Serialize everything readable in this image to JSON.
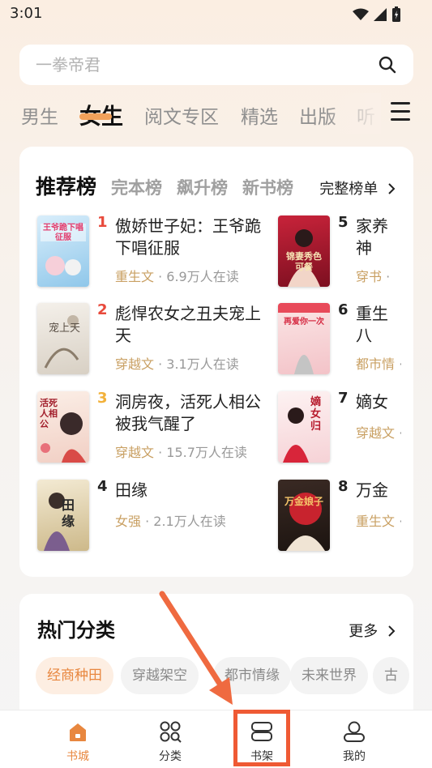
{
  "status": {
    "time": "3:01"
  },
  "search": {
    "placeholder": "一拳帝君"
  },
  "channels": [
    "男生",
    "女生",
    "阅文专区",
    "精选",
    "出版",
    "听"
  ],
  "rank": {
    "tabs": [
      "推荐榜",
      "完本榜",
      "飙升榜",
      "新书榜"
    ],
    "more": "完整榜单",
    "books": [
      {
        "rank": "1",
        "title": "傲娇世子妃：王爷跪下唱征服",
        "genre": "重生文",
        "readers": " · 6.9万人在读",
        "cover_text": "王爷跪下唱征服",
        "rank_color": "#e84a3c"
      },
      {
        "rank": "2",
        "title": "彪悍农女之丑夫宠上天",
        "genre": "穿越文",
        "readers": " · 3.1万人在读",
        "cover_text": "宠上天",
        "rank_color": "#e84a3c"
      },
      {
        "rank": "3",
        "title": "洞房夜，活死人相公被我气醒了",
        "genre": "穿越文",
        "readers": " · 15.7万人在读",
        "cover_text": "活死人相公",
        "rank_color": "#f2b13a"
      },
      {
        "rank": "4",
        "title": "田缘",
        "genre": "女强",
        "readers": " · 2.1万人在读",
        "cover_text": "田缘",
        "rank_color": "#222222"
      },
      {
        "rank": "5",
        "title": "家养神医：绝色可餐",
        "genre": "穿书",
        "readers": " · ",
        "cover_text": "锦妻秀色可餐",
        "rank_color": "#222222"
      },
      {
        "rank": "6",
        "title": "重生八零：再爱你一次",
        "genre": "都市情",
        "readers": " · ",
        "cover_text": "再爱你一次",
        "rank_color": "#222222"
      },
      {
        "rank": "7",
        "title": "嫡女归来",
        "genre": "穿越文",
        "readers": " · ",
        "cover_text": "嫡女归",
        "rank_color": "#222222"
      },
      {
        "rank": "8",
        "title": "万金娘子",
        "genre": "重生文",
        "readers": " · ",
        "cover_text": "万金娘子",
        "rank_color": "#222222"
      }
    ]
  },
  "hot": {
    "title": "热门分类",
    "more": "更多",
    "chips": [
      "经商种田",
      "穿越架空",
      "都市情缘",
      "未来世界",
      "古"
    ]
  },
  "nav": {
    "items": [
      {
        "label": "书城",
        "icon": "home-icon"
      },
      {
        "label": "分类",
        "icon": "category-icon"
      },
      {
        "label": "书架",
        "icon": "bookshelf-icon"
      },
      {
        "label": "我的",
        "icon": "profile-icon"
      }
    ]
  },
  "colors": {
    "accent": "#e8873f",
    "highlight": "#ef5a34",
    "genre": "#c9a063"
  }
}
